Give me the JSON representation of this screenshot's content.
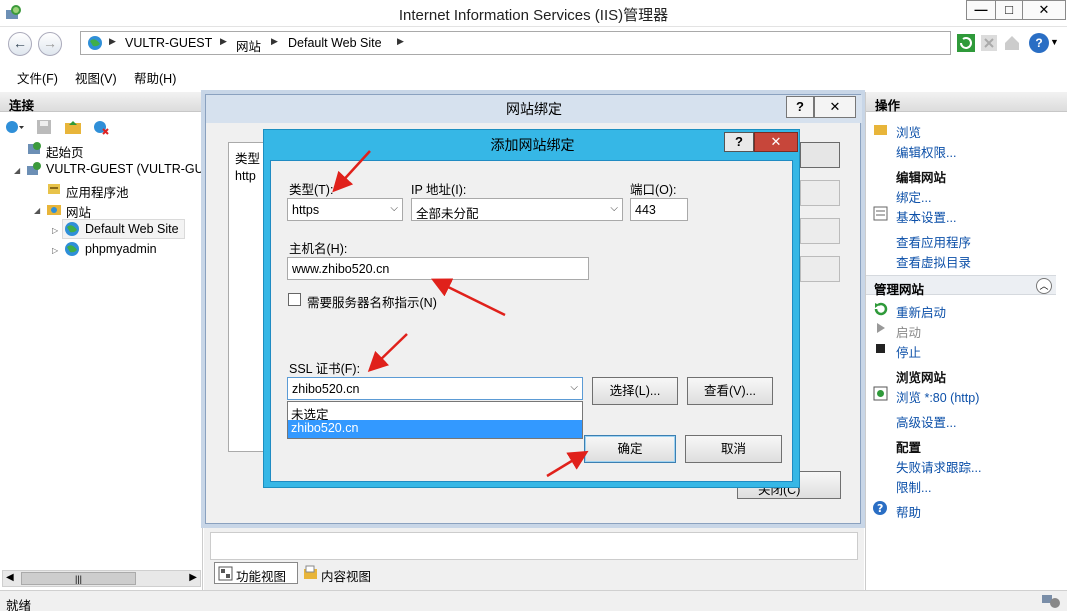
{
  "window": {
    "title": "Internet Information Services (IIS)管理器",
    "minimize": "—",
    "maximize": "□",
    "close": "✕"
  },
  "address": {
    "crumbs": [
      "VULTR-GUEST",
      "网站",
      "Default Web Site"
    ],
    "help_label": "?"
  },
  "menu": {
    "file": "文件(F)",
    "view": "视图(V)",
    "help": "帮助(H)"
  },
  "connections": {
    "header": "连接",
    "tree": {
      "start_page": "起始页",
      "server": "VULTR-GUEST (VULTR-GUE",
      "app_pools": "应用程序池",
      "sites": "网站",
      "site1": "Default Web Site",
      "site2": "phpmyadmin"
    },
    "scroll_thumb": "|||"
  },
  "actions": {
    "header": "操作",
    "browse": "浏览",
    "edit_permissions": "编辑权限...",
    "edit_site_head": "编辑网站",
    "bindings": "绑定...",
    "basic_settings": "基本设置...",
    "view_apps": "查看应用程序",
    "view_vdirs": "查看虚拟目录",
    "manage_site_head": "管理网站",
    "restart": "重新启动",
    "start": "启动",
    "stop": "停止",
    "browse_site_head": "浏览网站",
    "browse_80": "浏览 *:80 (http)",
    "advanced_settings": "高级设置...",
    "config_head": "配置",
    "failed_req_tracing": "失败请求跟踪...",
    "limits": "限制...",
    "help": "帮助"
  },
  "view_tabs": {
    "features": "功能视图",
    "content": "内容视图"
  },
  "status": {
    "text": "就绪"
  },
  "site_bindings_dialog": {
    "title": "网站绑定",
    "help_btn": "?",
    "close_btn": "✕",
    "col_type": "类型",
    "row_type": "http",
    "close_label_partial": "关闭(C)"
  },
  "add_binding_dialog": {
    "title": "添加网站绑定",
    "help_btn": "?",
    "close_btn": "✕",
    "type_label": "类型(T):",
    "type_value": "https",
    "ip_label": "IP 地址(I):",
    "ip_value": "全部未分配",
    "port_label": "端口(O):",
    "port_value": "443",
    "host_label": "主机名(H):",
    "host_value": "www.zhibo520.cn",
    "sni_label": "需要服务器名称指示(N)",
    "ssl_label": "SSL 证书(F):",
    "ssl_value": "zhibo520.cn",
    "ssl_options": [
      "未选定",
      "zhibo520.cn"
    ],
    "select_btn": "选择(L)...",
    "view_btn": "查看(V)...",
    "ok_btn": "确定",
    "cancel_btn": "取消"
  },
  "colors": {
    "dialog_frame": "#36b7e6",
    "close_red": "#c7463a",
    "link_blue": "#0b4fa8",
    "arrow_red": "#e0211b",
    "select_highlight": "#3399ff"
  }
}
